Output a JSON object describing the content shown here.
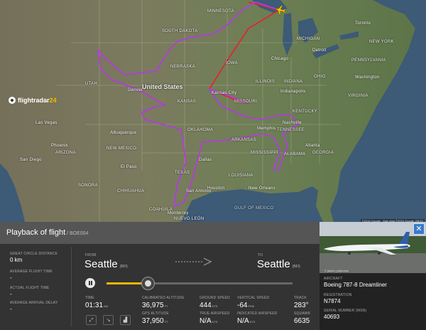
{
  "map": {
    "labels": {
      "minnesota": "MINNESOTA",
      "south_dakota": "SOUTH DAKOTA",
      "nebraska": "NEBRASKA",
      "united_states": "United States",
      "iowa": "IOWA",
      "illinois": "ILLINOIS",
      "indiana": "INDIANA",
      "ohio": "OHIO",
      "kansas": "KANSAS",
      "missouri": "MISSOURI",
      "kentucky": "KENTUCKY",
      "tennessee": "TENNESSEE",
      "oklahoma": "OKLAHOMA",
      "arkansas": "ARKANSAS",
      "mississippi": "MISSISSIPPI",
      "texas": "TEXAS",
      "new_mexico": "NEW MEXICO",
      "utah": "UTAH",
      "arizona": "ARIZONA",
      "sonora": "SONORA",
      "chihuahua": "CHIHUAHUA",
      "coahuila": "COAHUILA",
      "nuevo_leon": "NUEVO LEÓN",
      "michigan": "MICHIGAN",
      "pennsylvania": "PENNSYLVANIA",
      "new_york": "NEW YORK",
      "virginia": "VIRGINIA",
      "georgia": "GEORGIA",
      "alabama": "ALABAMA",
      "louisiana": "LOUISIANA",
      "chicago": "Chicago",
      "kansas_city": "Kansas City",
      "denver": "Denver",
      "dallas": "Dallas",
      "houston": "Houston",
      "san_antonio": "San Antonio",
      "atlanta": "Atlanta",
      "nashville": "Nashville",
      "indianapolis": "Indianapolis",
      "toronto": "Toronto",
      "detroit": "Detroit",
      "washington": "Washington",
      "las_vegas": "Las Vegas",
      "albuquerque": "Albuquerque",
      "san_diego": "San Diego",
      "phoenix": "Phoenix",
      "el_paso": "El Paso",
      "memphis": "Memphis",
      "new_orleans": "New Orleans",
      "monterrey": "Monterrey",
      "gulf": "Gulf of Mexico"
    },
    "attribution": "©2016 Google - Map data ©2016 Google, INEGI"
  },
  "panel": {
    "title": "Playback of flight",
    "flight_number": " / BOE004"
  },
  "left": {
    "great_circle_label": "GREAT CIRCLE DISTANCE",
    "great_circle_value": "0 km",
    "avg_flight_time_label": "AVERAGE FLIGHT TIME",
    "avg_flight_time_value": "-",
    "actual_flight_time_label": "ACTUAL FLIGHT TIME",
    "actual_flight_time_value": "-",
    "avg_arrival_delay_label": "AVERAGE ARRIVAL DELAY",
    "avg_arrival_delay_value": "-"
  },
  "logo": {
    "text": "flightradar",
    "num": "24"
  },
  "route": {
    "from_label": "FROM",
    "from_city": "Seattle",
    "from_code": "(BFI)",
    "to_label": "TO",
    "to_city": "Seattle",
    "to_code": "(BFI)"
  },
  "playback": {
    "progress": 0.22
  },
  "stats": {
    "time_label": "TIME",
    "time_value": "01:31",
    "time_unit": "AM",
    "cal_alt_label": "CALIBRATED ALTITUDE",
    "cal_alt_value": "36,975",
    "cal_alt_unit": "FT",
    "gps_alt_label": "GPS ALTITUDE",
    "gps_alt_value": "37,950",
    "gps_alt_unit": "FT",
    "ground_speed_label": "GROUND SPEED",
    "ground_speed_value": "444",
    "ground_speed_unit": "KTS",
    "true_airspeed_label": "TRUE AIRSPEED",
    "true_airspeed_value": "N/A",
    "true_airspeed_unit": "KTS",
    "vertical_speed_label": "VERTICAL SPEED",
    "vertical_speed_value": "-64",
    "vertical_speed_unit": "FPM",
    "indicated_airspeed_label": "INDICATED AIRSPEED",
    "indicated_airspeed_value": "N/A",
    "indicated_airspeed_unit": "KTS",
    "track_label": "TRACK",
    "track_value": "283°",
    "squawk_label": "SQUAWK",
    "squawk_value": "6635"
  },
  "controls": {
    "fit_icon": "expand-icon",
    "chart_icon": "chart-icon",
    "graph_icon": "bar-chart-icon"
  },
  "aircraft": {
    "photo_credit": "© jakubi | jetphotos",
    "aircraft_label": "AIRCRAFT",
    "aircraft_value": "Boeing 787-8 Dreamliner",
    "registration_label": "REGISTRATION",
    "registration_value": "N7874",
    "serial_label": "SERIAL NUMBER (MSN)",
    "serial_value": "40693"
  },
  "colors": {
    "accent": "#f5b700",
    "route_purple": "#b23ce0",
    "route_red": "#e8202a",
    "close_blue": "#3a7ac8"
  }
}
